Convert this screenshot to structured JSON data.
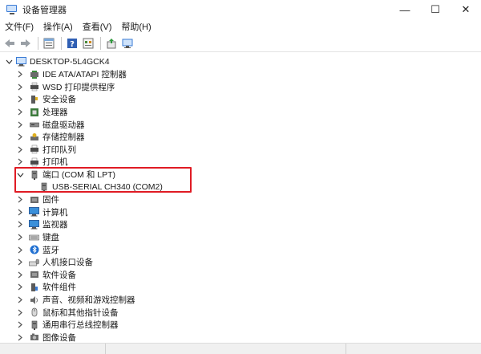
{
  "window": {
    "title": "设备管理器",
    "minimize_glyph": "—",
    "maximize_glyph": "☐",
    "close_glyph": "✕"
  },
  "menu": [
    "文件(F)",
    "操作(A)",
    "查看(V)",
    "帮助(H)"
  ],
  "toolbar": {
    "buttons": [
      "back-arrow-icon",
      "forward-arrow-icon",
      "properties-icon",
      "help-icon",
      "view-icon",
      "update-driver-icon",
      "scan-hardware-icon"
    ]
  },
  "tree": {
    "root": "DESKTOP-5L4GCK4",
    "categories": [
      {
        "label": "IDE ATA/ATAPI 控制器",
        "icon": "ide-controller-icon"
      },
      {
        "label": "WSD 打印提供程序",
        "icon": "wsd-printer-icon"
      },
      {
        "label": "安全设备",
        "icon": "security-device-icon"
      },
      {
        "label": "处理器",
        "icon": "processor-icon"
      },
      {
        "label": "磁盘驱动器",
        "icon": "disk-drive-icon"
      },
      {
        "label": "存储控制器",
        "icon": "storage-controller-icon"
      },
      {
        "label": "打印队列",
        "icon": "print-queue-icon"
      },
      {
        "label": "打印机",
        "icon": "printer-icon"
      },
      {
        "label": "端口 (COM 和 LPT)",
        "icon": "port-icon",
        "expanded": true,
        "children": [
          "USB-SERIAL CH340 (COM2)"
        ]
      },
      {
        "label": "固件",
        "icon": "firmware-icon"
      },
      {
        "label": "计算机",
        "icon": "computer-icon"
      },
      {
        "label": "监视器",
        "icon": "monitor-icon"
      },
      {
        "label": "键盘",
        "icon": "keyboard-icon"
      },
      {
        "label": "蓝牙",
        "icon": "bluetooth-icon"
      },
      {
        "label": "人机接口设备",
        "icon": "hid-icon"
      },
      {
        "label": "软件设备",
        "icon": "software-device-icon"
      },
      {
        "label": "软件组件",
        "icon": "software-component-icon"
      },
      {
        "label": "声音、视频和游戏控制器",
        "icon": "sound-icon"
      },
      {
        "label": "鼠标和其他指针设备",
        "icon": "mouse-icon"
      },
      {
        "label": "通用串行总线控制器",
        "icon": "usb-icon"
      },
      {
        "label": "图像设备",
        "icon": "imaging-icon"
      }
    ]
  },
  "colors": {
    "highlight_border": "#e01b24",
    "accent": "#3a7bd5"
  }
}
